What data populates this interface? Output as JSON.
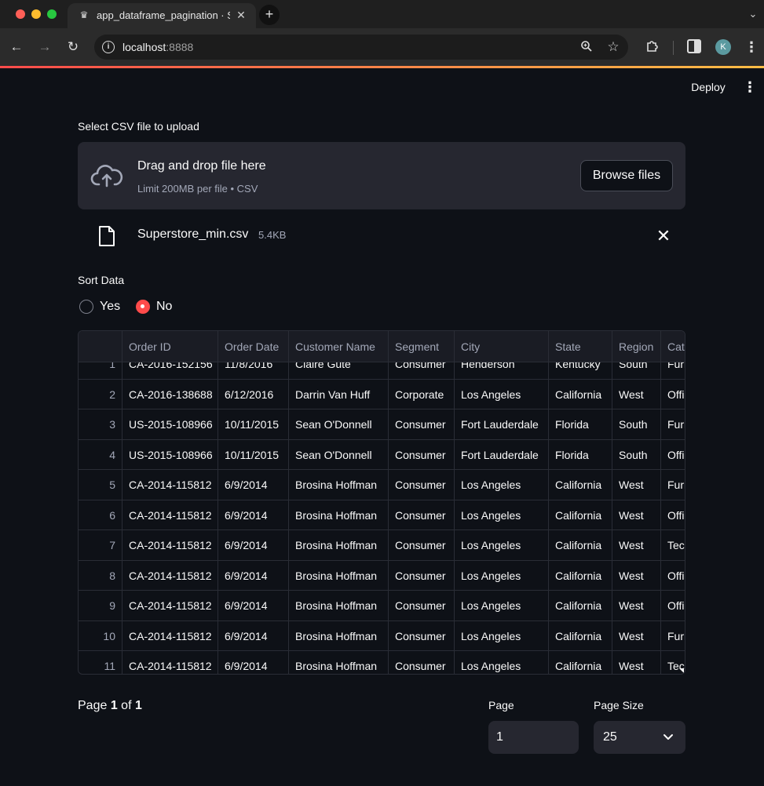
{
  "browser": {
    "tab_title": "app_dataframe_pagination · Streamlit",
    "url_host": "localhost",
    "url_port": ":8888",
    "avatar_letter": "K"
  },
  "app": {
    "deploy_label": "Deploy"
  },
  "uploader": {
    "label": "Select CSV file to upload",
    "drop_title": "Drag and drop file here",
    "drop_sub": "Limit 200MB per file • CSV",
    "browse_label": "Browse files",
    "file_name": "Superstore_min.csv",
    "file_size": "5.4KB"
  },
  "sort": {
    "label": "Sort Data",
    "options": [
      "Yes",
      "No"
    ],
    "selected": "No"
  },
  "table": {
    "columns": [
      "Order ID",
      "Order Date",
      "Customer Name",
      "Segment",
      "City",
      "State",
      "Region",
      "Category"
    ],
    "rows": [
      [
        "1",
        "CA-2016-152156",
        "11/8/2016",
        "Claire Gute",
        "Consumer",
        "Henderson",
        "Kentucky",
        "South",
        "Furniture"
      ],
      [
        "2",
        "CA-2016-138688",
        "6/12/2016",
        "Darrin Van Huff",
        "Corporate",
        "Los Angeles",
        "California",
        "West",
        "Office Supplies"
      ],
      [
        "3",
        "US-2015-108966",
        "10/11/2015",
        "Sean O'Donnell",
        "Consumer",
        "Fort Lauderdale",
        "Florida",
        "South",
        "Furniture"
      ],
      [
        "4",
        "US-2015-108966",
        "10/11/2015",
        "Sean O'Donnell",
        "Consumer",
        "Fort Lauderdale",
        "Florida",
        "South",
        "Office Supplies"
      ],
      [
        "5",
        "CA-2014-115812",
        "6/9/2014",
        "Brosina Hoffman",
        "Consumer",
        "Los Angeles",
        "California",
        "West",
        "Furniture"
      ],
      [
        "6",
        "CA-2014-115812",
        "6/9/2014",
        "Brosina Hoffman",
        "Consumer",
        "Los Angeles",
        "California",
        "West",
        "Office Supplies"
      ],
      [
        "7",
        "CA-2014-115812",
        "6/9/2014",
        "Brosina Hoffman",
        "Consumer",
        "Los Angeles",
        "California",
        "West",
        "Technology"
      ],
      [
        "8",
        "CA-2014-115812",
        "6/9/2014",
        "Brosina Hoffman",
        "Consumer",
        "Los Angeles",
        "California",
        "West",
        "Office Supplies"
      ],
      [
        "9",
        "CA-2014-115812",
        "6/9/2014",
        "Brosina Hoffman",
        "Consumer",
        "Los Angeles",
        "California",
        "West",
        "Office Supplies"
      ],
      [
        "10",
        "CA-2014-115812",
        "6/9/2014",
        "Brosina Hoffman",
        "Consumer",
        "Los Angeles",
        "California",
        "West",
        "Furniture"
      ],
      [
        "11",
        "CA-2014-115812",
        "6/9/2014",
        "Brosina Hoffman",
        "Consumer",
        "Los Angeles",
        "California",
        "West",
        "Technology"
      ]
    ]
  },
  "pagination": {
    "page_prefix": "Page ",
    "page_current": "1",
    "page_of": " of ",
    "page_total": "1",
    "page_label": "Page",
    "page_value": "1",
    "page_size_label": "Page Size",
    "page_size_value": "25"
  },
  "colors": {
    "background": "#0e1117",
    "surface": "#262730",
    "accent": "#ff4b4b"
  },
  "icons": [
    "streamlit-icon",
    "close-icon",
    "plus-icon",
    "chevron-down-icon",
    "back-icon",
    "forward-icon",
    "reload-icon",
    "info-icon",
    "zoom-icon",
    "star-icon",
    "extensions-icon",
    "side-panel-icon",
    "menu-icon",
    "cloud-upload-icon",
    "file-icon"
  ]
}
